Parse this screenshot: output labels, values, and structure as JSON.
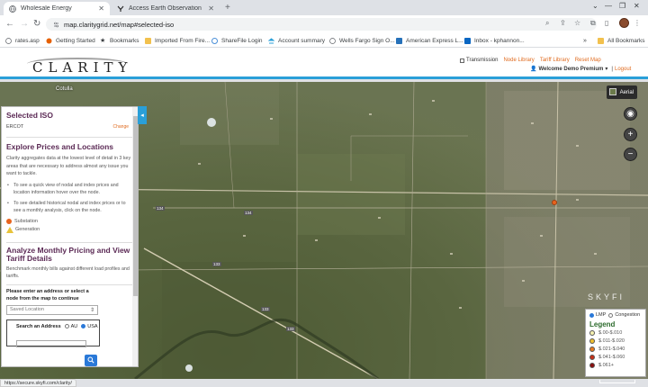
{
  "browser": {
    "tabs": [
      {
        "title": "Wholesale Energy",
        "active": true
      },
      {
        "title": "Access Earth Observation Data ...",
        "active": false
      }
    ],
    "url": "map.claritygrid.net/map#selected-iso",
    "bookmarks": [
      "rates.asp",
      "Getting Started",
      "Bookmarks",
      "Imported From Fire...",
      "ShareFile Login",
      "Account summary",
      "Wells Fargo Sign O...",
      "American Express L...",
      "Inbox - kphannon...",
      "All Bookmarks"
    ],
    "status_url": "https://secure.skyfi.com/clarity/"
  },
  "header": {
    "logo_text": "CLARITY",
    "transmission_label": "Transmission",
    "links": [
      "Node Library",
      "Tariff Library",
      "Reset Map"
    ],
    "welcome": "Welcome Demo Premium",
    "logout": "Logout"
  },
  "map": {
    "city_label": "Cotulla",
    "layer_button": "Aerial",
    "watermark": "SKYFI",
    "road_labels": [
      "134",
      "134",
      "133",
      "133",
      "133"
    ]
  },
  "panel": {
    "selected_iso_title": "Selected ISO",
    "iso_value": "ERCOT",
    "change_label": "Change",
    "explore_title": "Explore Prices and Locations",
    "explore_text": "Clarity aggregates data at the lowest level of detail in 3 key areas that are necessary to address almost any issue you want to tackle.",
    "bullets": [
      "To see a quick view of nodal and index prices and location information hover over the node.",
      "To see detailed historical nodal and index prices or to see a monthly analysis, click on the node."
    ],
    "substation_label": "Substation",
    "generation_label": "Generation",
    "analyze_title_1": "Analyze Monthly Pricing and View",
    "analyze_title_2": "Tariff Details",
    "analyze_text": "Benchmark monthly bills against different load profiles and tariffs.",
    "form_prompt_1": "Please enter an address or select a",
    "form_prompt_2": "node from the map to continue",
    "saved_location_placeholder": "Saved Location",
    "search_label": "Search an Address",
    "radio_au": "AU",
    "radio_usa": "USA"
  },
  "legend": {
    "mode_lmp": "LMP",
    "mode_congestion": "Congestion",
    "title": "Legend",
    "items": [
      {
        "label": "$.00-$.010",
        "color": "#f5f0b0"
      },
      {
        "label": "$.011-$.020",
        "color": "#f0c030"
      },
      {
        "label": "$.021-$.040",
        "color": "#e87a20"
      },
      {
        "label": "$.041-$.060",
        "color": "#c43018"
      },
      {
        "label": "$.061+",
        "color": "#8a1010"
      }
    ]
  },
  "colors": {
    "accent_blue": "#2a9fd8",
    "link_orange": "#e06b1f",
    "heading_purple": "#5b2a55",
    "substation_orange": "#e8641e",
    "generation_yellow": "#e8c33a"
  }
}
